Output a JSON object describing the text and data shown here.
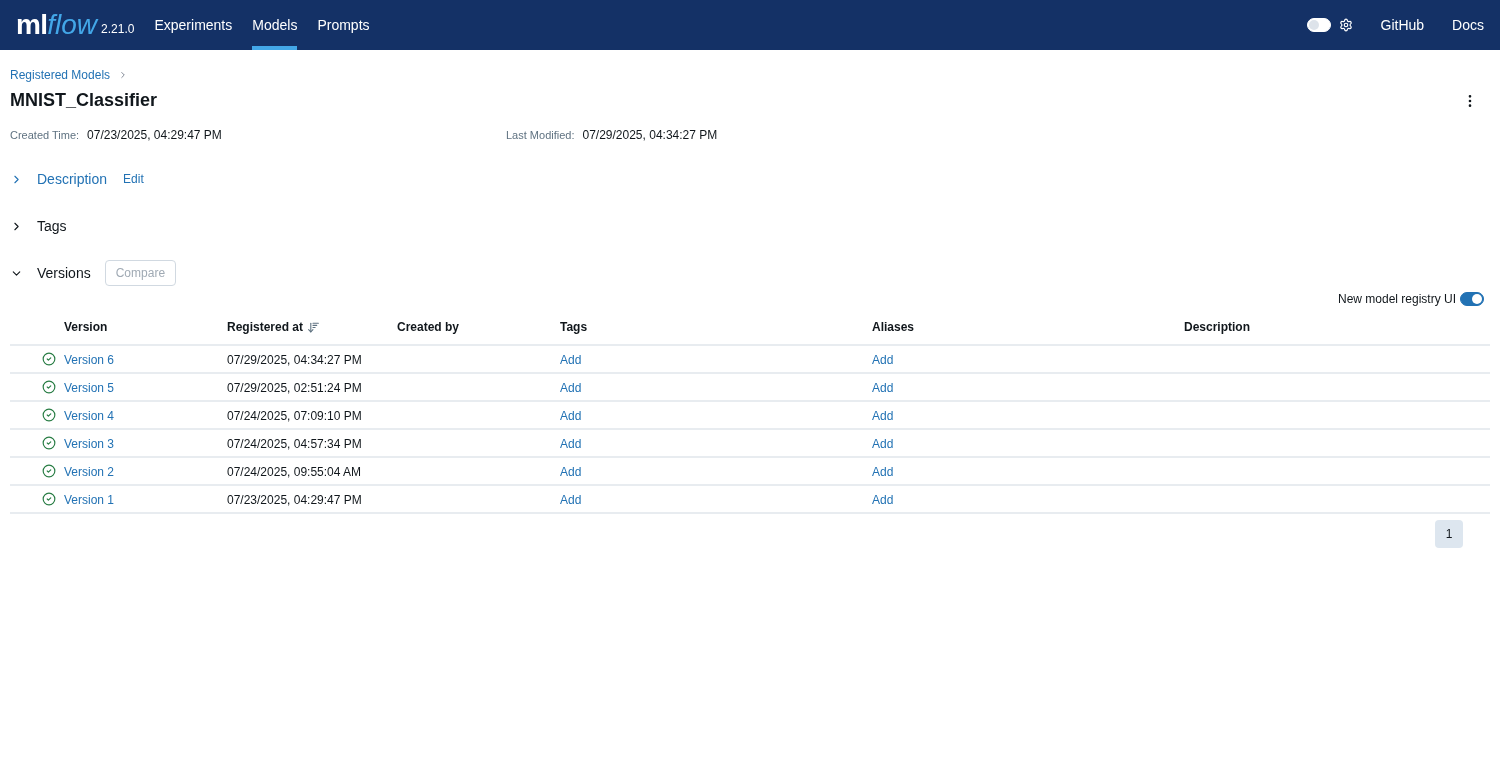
{
  "header": {
    "logo": {
      "part_1": "ml",
      "part_2": "flow"
    },
    "version": "2.21.0",
    "nav": [
      {
        "label": "Experiments",
        "selected": false
      },
      {
        "label": "Models",
        "selected": true
      },
      {
        "label": "Prompts",
        "selected": false
      }
    ],
    "dark_mode_toggle": {
      "on": false
    },
    "links": [
      "GitHub",
      "Docs"
    ]
  },
  "breadcrumb": "Registered Models",
  "title": "MNIST_Classifier",
  "meta": [
    {
      "label": "Created Time:",
      "value": "07/23/2025, 04:29:47 PM"
    },
    {
      "label": "Last Modified:",
      "value": "07/29/2025, 04:34:27 PM"
    }
  ],
  "sections": [
    {
      "title": "Description",
      "expanded": false,
      "action": "Edit",
      "kind": "link"
    },
    {
      "title": "Tags",
      "expanded": false
    },
    {
      "title": "Versions",
      "expanded": true,
      "action": "Compare",
      "kind": "button"
    }
  ],
  "registry_toggle": {
    "label": "New model registry UI",
    "on": true
  },
  "table": {
    "columns": [
      "Version",
      "Registered at",
      "Created by",
      "Tags",
      "Aliases",
      "Description"
    ],
    "rows": [
      {
        "version": "Version 6",
        "registered_at": "07/29/2025, 04:34:27 PM",
        "tags": "Add",
        "aliases": "Add",
        "ready": true
      },
      {
        "version": "Version 5",
        "registered_at": "07/29/2025, 02:51:24 PM",
        "tags": "Add",
        "aliases": "Add",
        "ready": true
      },
      {
        "version": "Version 4",
        "registered_at": "07/24/2025, 07:09:10 PM",
        "tags": "Add",
        "aliases": "Add",
        "ready": true
      },
      {
        "version": "Version 3",
        "registered_at": "07/24/2025, 04:57:34 PM",
        "tags": "Add",
        "aliases": "Add",
        "ready": true
      },
      {
        "version": "Version 2",
        "registered_at": "07/24/2025, 09:55:04 AM",
        "tags": "Add",
        "aliases": "Add",
        "ready": true
      },
      {
        "version": "Version 1",
        "registered_at": "07/23/2025, 04:29:47 PM",
        "tags": "Add",
        "aliases": "Add",
        "ready": true
      }
    ]
  },
  "pagination": [
    {
      "label": "1",
      "selected": true
    }
  ]
}
